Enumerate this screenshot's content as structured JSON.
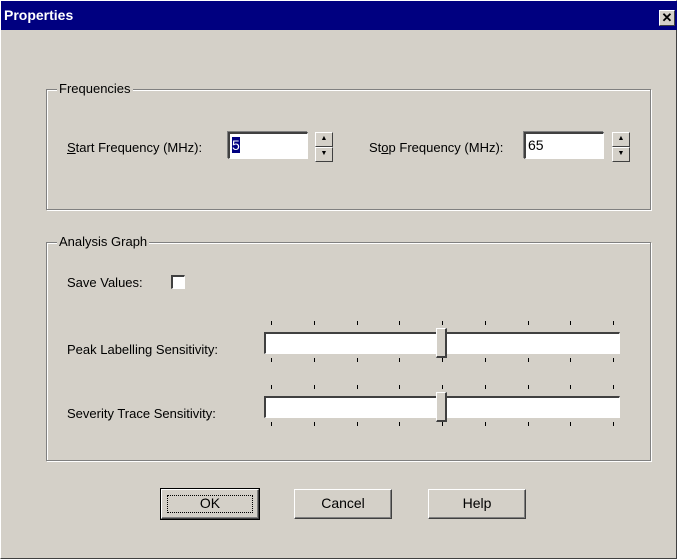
{
  "window": {
    "title": "Properties",
    "close_symbol": "✕"
  },
  "frequencies": {
    "group_label": "Frequencies",
    "start": {
      "label_hotkey": "S",
      "label_rest": "tart Frequency (MHz):",
      "value": "5"
    },
    "stop": {
      "label_pre": "St",
      "label_hotkey": "o",
      "label_rest": "p Frequency (MHz):",
      "value": "65"
    }
  },
  "analysis_graph": {
    "group_label": "Analysis Graph",
    "save_values_label": "Save Values:",
    "save_values_checked": false,
    "peak_label": "Peak Labelling Sensitivity:",
    "peak_level": 0.5,
    "severity_label": "Severity Trace Sensitivity:",
    "severity_level": 0.5,
    "tick_count": 9
  },
  "buttons": {
    "ok": "OK",
    "cancel": "Cancel",
    "help": "Help"
  }
}
